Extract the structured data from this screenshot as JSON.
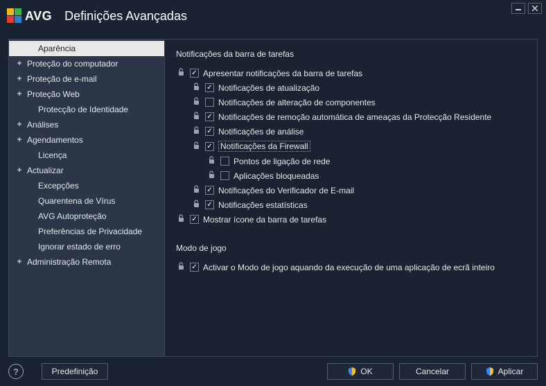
{
  "logo_text": "AVG",
  "window_title": "Definições Avançadas",
  "sidebar": {
    "items": [
      {
        "label": "Aparência",
        "expandable": false,
        "child": true,
        "selected": true
      },
      {
        "label": "Proteção do computador",
        "expandable": true
      },
      {
        "label": "Proteção de e-mail",
        "expandable": true
      },
      {
        "label": "Proteção Web",
        "expandable": true
      },
      {
        "label": "Protecção de Identidade",
        "child": true
      },
      {
        "label": "Análises",
        "expandable": true
      },
      {
        "label": "Agendamentos",
        "expandable": true
      },
      {
        "label": "Licença",
        "child": true
      },
      {
        "label": "Actualizar",
        "expandable": true
      },
      {
        "label": "Excepções",
        "child": true
      },
      {
        "label": "Quarentena de Vírus",
        "child": true
      },
      {
        "label": "AVG Autoproteção",
        "child": true
      },
      {
        "label": "Preferências de Privacidade",
        "child": true
      },
      {
        "label": "Ignorar estado de erro",
        "child": true
      },
      {
        "label": "Administração Remota",
        "expandable": true
      }
    ]
  },
  "content": {
    "section1_title": "Notificações da barra de tarefas",
    "options": [
      {
        "indent": 0,
        "lock": true,
        "checked": true,
        "label": "Apresentar notificações da barra de tarefas"
      },
      {
        "indent": 1,
        "lock": true,
        "checked": true,
        "label": "Notificações de atualização"
      },
      {
        "indent": 1,
        "lock": true,
        "checked": false,
        "label": "Notificações de alteração de componentes"
      },
      {
        "indent": 1,
        "lock": true,
        "checked": true,
        "label": "Notificações de remoção automática de ameaças da Protecção Residente"
      },
      {
        "indent": 1,
        "lock": true,
        "checked": true,
        "label": "Notificações de análise"
      },
      {
        "indent": 1,
        "lock": true,
        "checked": true,
        "label": "Notificações da Firewall",
        "focused": true
      },
      {
        "indent": 2,
        "lock": true,
        "checked": false,
        "label": "Pontos de ligação de rede"
      },
      {
        "indent": 2,
        "lock": true,
        "checked": false,
        "label": "Aplicações bloqueadas"
      },
      {
        "indent": 1,
        "lock": true,
        "checked": true,
        "label": "Notificações do Verificador de E-mail"
      },
      {
        "indent": 1,
        "lock": true,
        "checked": true,
        "label": "Notificações estatísticas"
      },
      {
        "indent": 0,
        "lock": true,
        "checked": true,
        "label": "Mostrar ícone da barra de tarefas"
      }
    ],
    "section2_title": "Modo de jogo",
    "option_game": {
      "checked": true,
      "label": "Activar o Modo de jogo aquando da execução de uma aplicação de ecrã inteiro"
    }
  },
  "footer": {
    "predef": "Predefinição",
    "ok": "OK",
    "cancel": "Cancelar",
    "apply": "Aplicar"
  }
}
